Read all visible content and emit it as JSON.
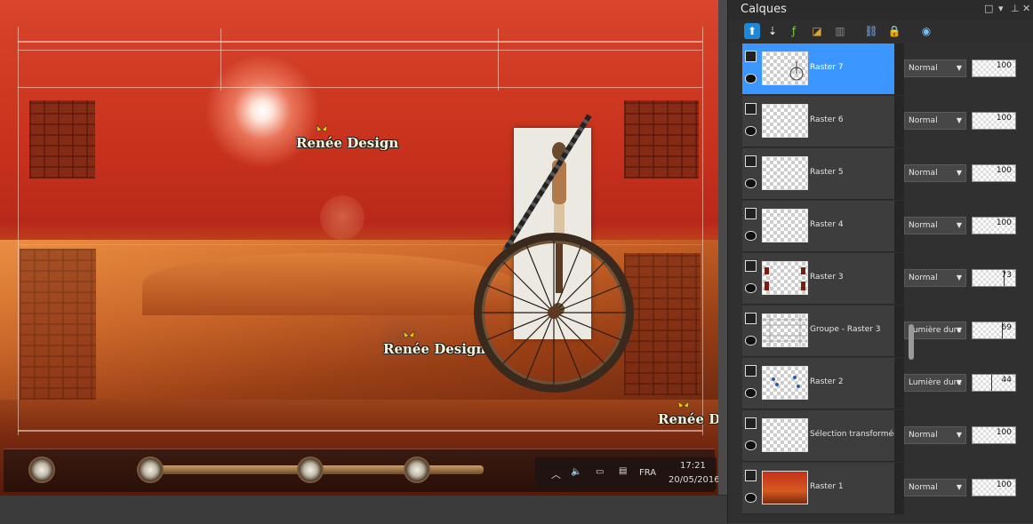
{
  "panel": {
    "title": "Calques",
    "header_buttons": [
      "□",
      "▾",
      "⊥",
      "✕"
    ]
  },
  "toolbar_icons": [
    "new-raster-layer-icon",
    "new-vector-layer-icon",
    "new-art-media-layer-icon",
    "new-mask-layer-icon",
    "duplicate-layer-icon",
    "link-icon",
    "lock-icon",
    "layer-styles-icon"
  ],
  "layers": [
    {
      "name": "Raster 7",
      "blend": "Normal",
      "opacity": "100",
      "selected": true
    },
    {
      "name": "Raster 6",
      "blend": "Normal",
      "opacity": "100",
      "selected": false
    },
    {
      "name": "Raster 5",
      "blend": "Normal",
      "opacity": "100",
      "selected": false
    },
    {
      "name": "Raster 4",
      "blend": "Normal",
      "opacity": "100",
      "selected": false
    },
    {
      "name": "Raster 3",
      "blend": "Normal",
      "opacity": "73",
      "selected": false
    },
    {
      "name": "Groupe - Raster 3",
      "blend": "Lumière dure",
      "opacity": "69",
      "selected": false
    },
    {
      "name": "Raster 2",
      "blend": "Lumière dure",
      "opacity": "44",
      "selected": false
    },
    {
      "name": "Sélection transformée",
      "blend": "Normal",
      "opacity": "100",
      "selected": false
    },
    {
      "name": "Raster 1",
      "blend": "Normal",
      "opacity": "100",
      "selected": false
    }
  ],
  "artwork": {
    "watermarks": [
      "Renée Design",
      "Renée Design",
      "Renée Design"
    ]
  },
  "tray": {
    "language": "FRA",
    "time": "17:21",
    "date": "20/05/2016"
  },
  "colors": {
    "selection": "#3b97ff",
    "panel_bg": "#303030"
  }
}
